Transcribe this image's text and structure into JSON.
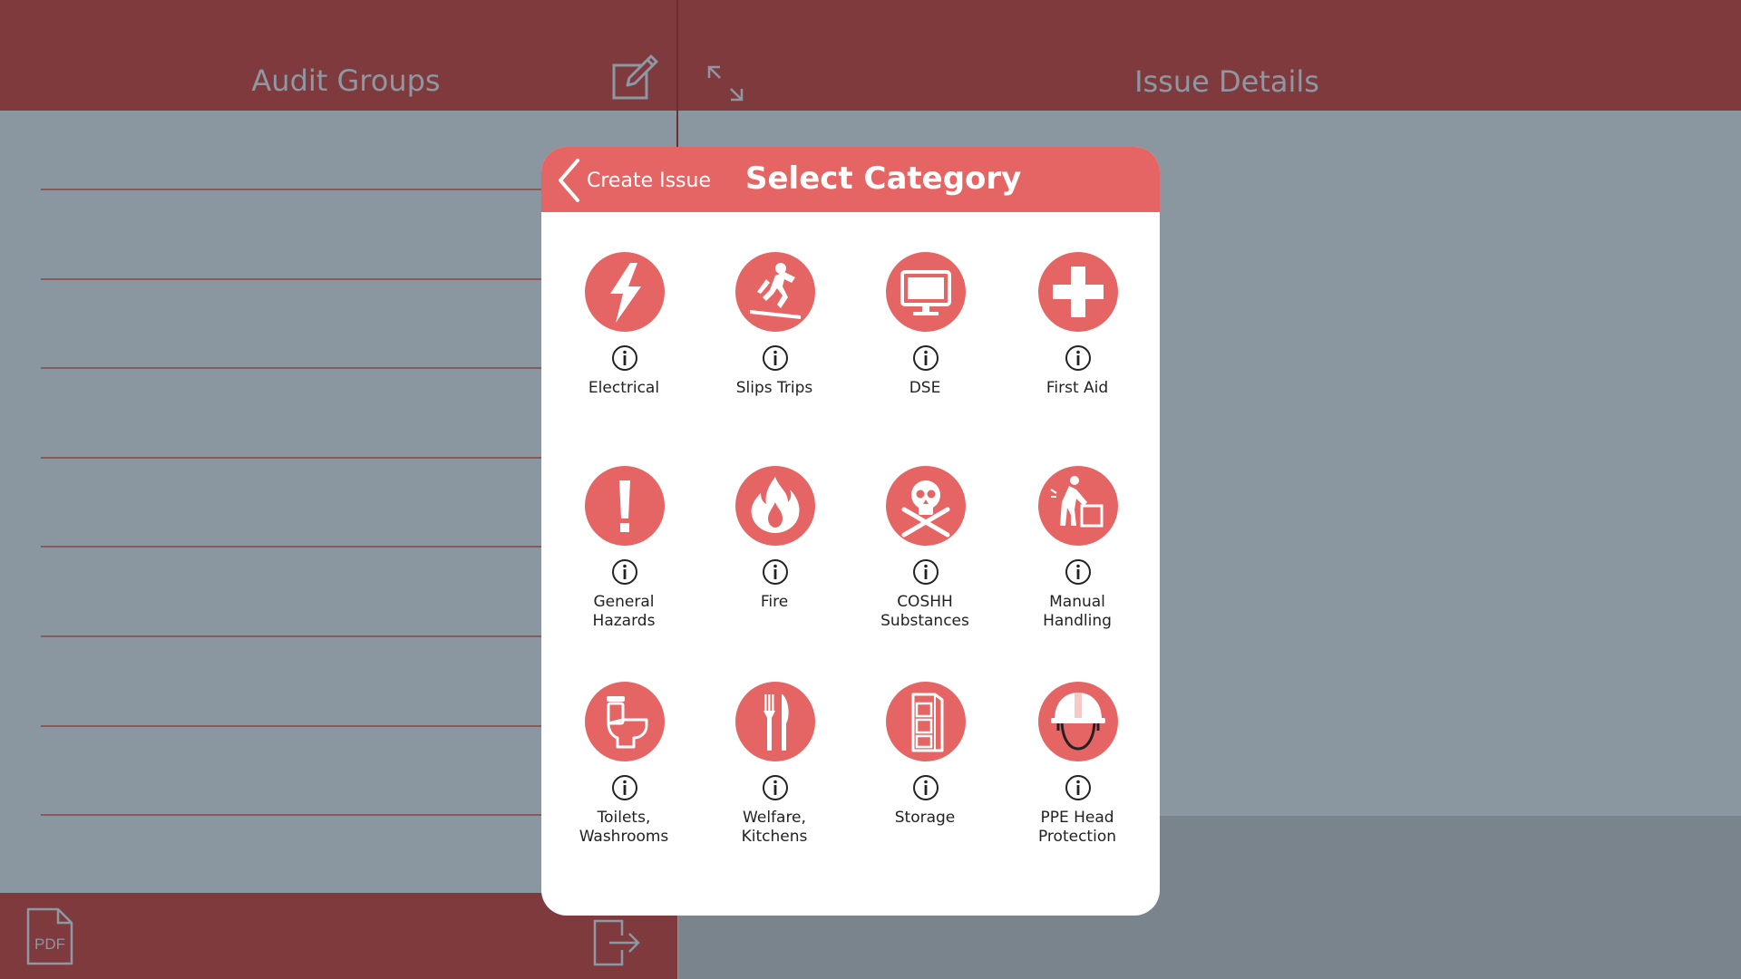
{
  "left_pane": {
    "title": "Audit Groups",
    "footer_pdf_label": "PDF"
  },
  "right_pane": {
    "title": "Issue Details"
  },
  "modal": {
    "back_label": "Create Issue",
    "title": "Select Category",
    "categories": [
      {
        "label": "Electrical",
        "icon": "lightning-bolt-icon"
      },
      {
        "label": "Slips Trips",
        "icon": "slipping-person-icon"
      },
      {
        "label": "DSE",
        "icon": "monitor-icon"
      },
      {
        "label": "First Aid",
        "icon": "first-aid-cross-icon"
      },
      {
        "label": "General\nHazards",
        "icon": "exclamation-icon"
      },
      {
        "label": "Fire",
        "icon": "flame-icon"
      },
      {
        "label": "COSHH\nSubstances",
        "icon": "skull-crossbones-icon"
      },
      {
        "label": "Manual\nHandling",
        "icon": "lifting-box-icon"
      },
      {
        "label": "Toilets,\nWashrooms",
        "icon": "toilet-icon"
      },
      {
        "label": "Welfare,\nKitchens",
        "icon": "fork-knife-icon"
      },
      {
        "label": "Storage",
        "icon": "filing-cabinet-icon"
      },
      {
        "label": "PPE Head\nProtection",
        "icon": "hard-hat-icon"
      }
    ]
  },
  "colors": {
    "header_red": "#7f3a3e",
    "accent_coral": "#e56564",
    "pane_gray": "#8a96a0"
  }
}
